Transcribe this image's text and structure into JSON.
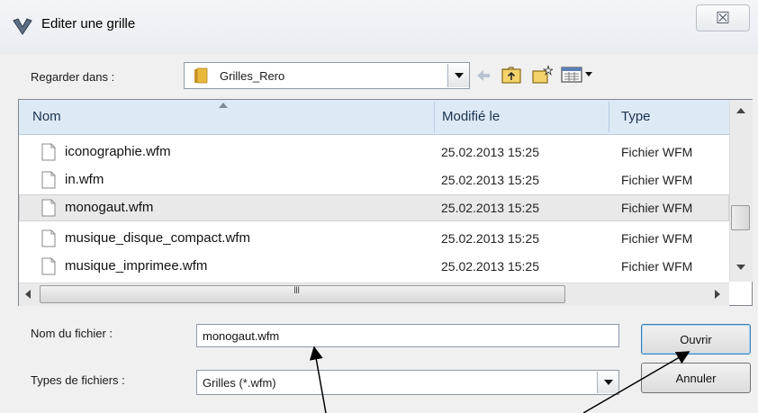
{
  "window": {
    "title": "Editer une grille",
    "close_glyph": "☒"
  },
  "look_in": {
    "label": "Regarder dans :",
    "value": "Grilles_Rero"
  },
  "list": {
    "columns": [
      "Nom",
      "Modifié le",
      "Type"
    ],
    "rows": [
      {
        "name": "iconographie.wfm",
        "modified": "25.02.2013 15:25",
        "type": "Fichier WFM"
      },
      {
        "name": "in.wfm",
        "modified": "25.02.2013 15:25",
        "type": "Fichier WFM"
      },
      {
        "name": "monogaut.wfm",
        "modified": "25.02.2013 15:25",
        "type": "Fichier WFM"
      },
      {
        "name": "musique_disque_compact.wfm",
        "modified": "25.02.2013 15:25",
        "type": "Fichier WFM"
      },
      {
        "name": "musique_imprimee.wfm",
        "modified": "25.02.2013 15:25",
        "type": "Fichier WFM"
      }
    ],
    "selected_index": 2,
    "hscroll_grip": "III"
  },
  "filename": {
    "label": "Nom du fichier :",
    "value": "monogaut.wfm"
  },
  "filetypes": {
    "label": "Types de fichiers :",
    "value": "Grilles (*.wfm)"
  },
  "buttons": {
    "open": "Ouvrir",
    "cancel": "Annuler"
  },
  "icons": {
    "title": "app-check-icon",
    "folder": "folder-icon",
    "back": "back-arrow-icon",
    "up": "up-folder-icon",
    "new": "new-folder-icon",
    "view": "view-menu-icon",
    "file": "file-icon"
  },
  "colors": {
    "header_bg": "#dde9f5",
    "selection_bg": "#e9e9e9",
    "folder_yellow": "#e8b93a"
  }
}
